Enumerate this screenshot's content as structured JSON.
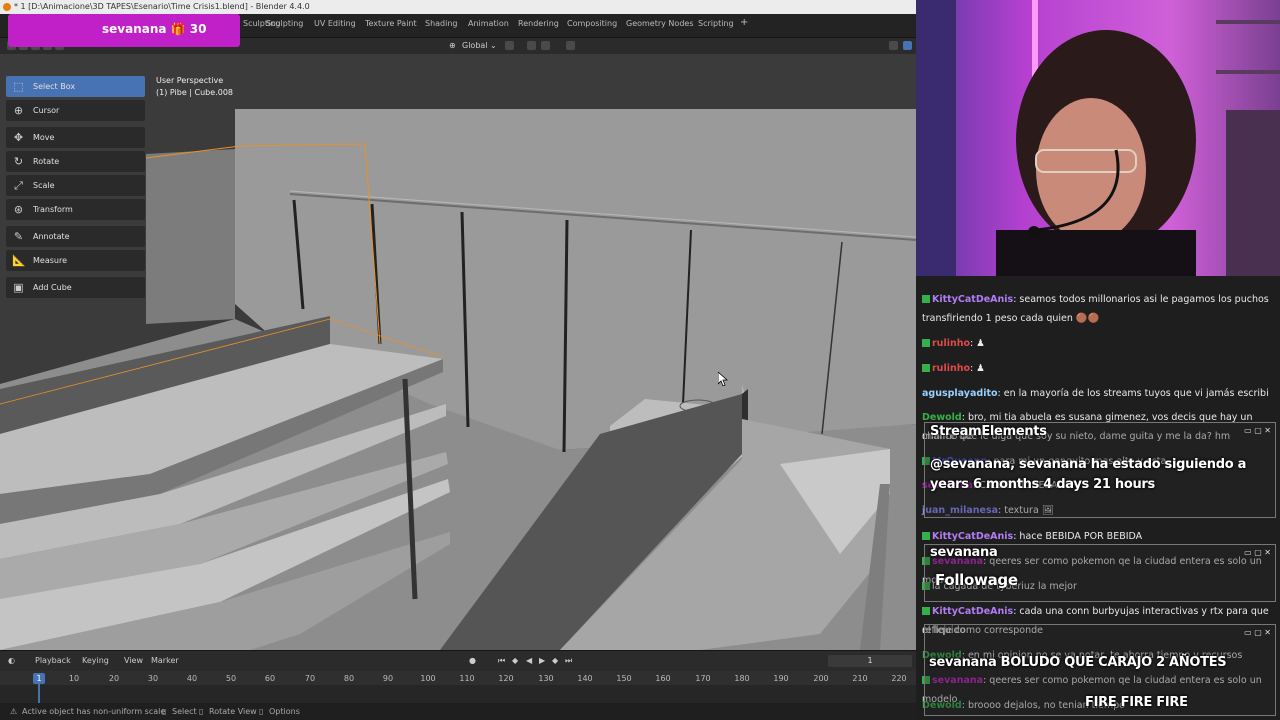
{
  "window": {
    "title": "* 1 [D:\\Animacione\\3D TAPES\\Esenario\\Time Crisis1.blend] - Blender 4.4.0"
  },
  "workspace_tabs": [
    "Sculpting",
    "UV Editing",
    "Texture Paint",
    "Shading",
    "Animation",
    "Rendering",
    "Compositing",
    "Geometry Nodes",
    "Scripting"
  ],
  "add_tab": "+",
  "viewport_header": {
    "transform_orientation": "Global"
  },
  "viewport": {
    "perspective": "User Perspective",
    "object_info": "(1) Pibe | Cube.008"
  },
  "tools": [
    {
      "label": "Select Box",
      "icon": "select-box-icon",
      "active": true
    },
    {
      "label": "Cursor",
      "icon": "cursor-icon",
      "active": false
    },
    {
      "label": "Move",
      "icon": "move-icon",
      "active": false
    },
    {
      "label": "Rotate",
      "icon": "rotate-icon",
      "active": false
    },
    {
      "label": "Scale",
      "icon": "scale-icon",
      "active": false
    },
    {
      "label": "Transform",
      "icon": "transform-icon",
      "active": false
    },
    {
      "label": "Annotate",
      "icon": "annotate-icon",
      "active": false
    },
    {
      "label": "Measure",
      "icon": "measure-icon",
      "active": false
    },
    {
      "label": "Add Cube",
      "icon": "add-cube-icon",
      "active": false
    }
  ],
  "timeline": {
    "menus": [
      "Playback",
      "Keying",
      "View",
      "Marker"
    ],
    "current_frame": "1",
    "playhead_label": "1",
    "ticks": [
      "10",
      "20",
      "30",
      "40",
      "50",
      "60",
      "70",
      "80",
      "90",
      "100",
      "110",
      "120",
      "130",
      "140",
      "150",
      "160",
      "170",
      "180",
      "190",
      "200",
      "210",
      "220"
    ]
  },
  "statusbar": {
    "message": "Active object has non-uniform scale",
    "select": "Select",
    "rotate_view": "Rotate View",
    "options": "Options"
  },
  "sub_badge": {
    "text": "sevanana 🎁 30"
  },
  "chat": {
    "messages": [
      {
        "user": "KittyCatDeAnis",
        "text": "seamos todos millonarios asi le pagamos los puchos",
        "color": "#b27cf5"
      },
      {
        "user": "",
        "text": "transfiriendo 1 peso cada quien",
        "color": ""
      },
      {
        "user": "rulinho",
        "text": "",
        "color": "#e04a4a"
      },
      {
        "user": "rulinho",
        "text": "",
        "color": "#e04a4a"
      },
      {
        "user": "agusplayadito",
        "text": "en la mayoría de los streams tuyos que vi jamás escribi",
        "color": "#9ad0ff"
      },
      {
        "user": "Dewold",
        "text": "bro, mi tia abuela es susana gimenez, vos decis que hay un minimo de",
        "color": "#35b04a"
      },
      {
        "user": "",
        "text": "chance que le diga que soy su nieto, dame guita y me la da? hm",
        "color": ""
      },
      {
        "user": "MrQueenn",
        "text": "para mi un gonguito mas alto y esta",
        "color": "#6060ff"
      },
      {
        "user": "sevanana",
        "text": "CALDO MODEBADER",
        "color": "#c020c8"
      },
      {
        "user": "juan_milanesa",
        "text": "textura",
        "color": "#8888ff"
      },
      {
        "user": "KittyCatDeAnis",
        "text": "hace BEBIDA POR BEBIDA",
        "color": "#b27cf5"
      },
      {
        "user": "sevanana",
        "text": "qeeres ser como pokemon qe la ciudad entera es solo un modelo",
        "color": "#c020c8"
      },
      {
        "user": "",
        "text": "la cagada de tyberiuz la mejor",
        "color": ""
      },
      {
        "user": "KittyCatDeAnis",
        "text": "cada una conn burbyujas interactivas y rtx para que el liquido",
        "color": "#b27cf5"
      },
      {
        "user": "",
        "text": "refleje como corresponde",
        "color": ""
      },
      {
        "user": "Dewold",
        "text": "en mi opinion no se va notar, te ahorra tiempo y recursos",
        "color": "#35b04a"
      },
      {
        "user": "sevanana",
        "text": "qeeres ser como pokemon qe la ciudad entera es solo un modelo",
        "color": "#c020c8"
      },
      {
        "user": "Dewold",
        "text": "broooo dejalos, no tenian tiempo",
        "color": "#35b04a"
      }
    ],
    "overlays": {
      "stream_elements": "StreamElements",
      "follow_alert": "@sevanana, sevanana ha estado siguiendo a years 6 months 4 days 21 hours",
      "follow_name": "sevanana",
      "followage": "Followage",
      "comment_name": "sevanana BOLUDO QUE CARAJO 2 AÑOTES",
      "fire": "FIRE FIRE FIRE"
    }
  },
  "colors": {
    "accent": "#4772b3",
    "badge_bg": "#c020c8",
    "selection_outline": "#e8912b"
  }
}
